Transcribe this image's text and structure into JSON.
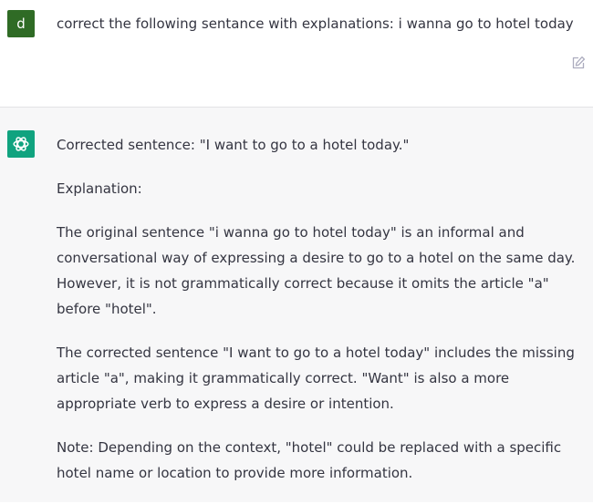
{
  "user_message": {
    "avatar_letter": "d",
    "text": "correct the following sentance with explanations: i wanna go to hotel today"
  },
  "assistant_message": {
    "paragraphs": [
      "Corrected sentence: \"I want to go to a hotel today.\"",
      "Explanation:",
      "The original sentence \"i wanna go to hotel today\" is an informal and conversational way of expressing a desire to go to a hotel on the same day. However, it is not grammatically correct because it omits the article \"a\" before \"hotel\".",
      "The corrected sentence \"I want to go to a hotel today\" includes the missing article \"a\", making it grammatically correct. \"Want\" is also a more appropriate verb to express a desire or intention.",
      "Note: Depending on the context, \"hotel\" could be replaced with a specific hotel name or location to provide more information."
    ]
  },
  "colors": {
    "user_avatar": "#2f6b25",
    "assistant_avatar": "#10a37f",
    "assistant_background": "#f7f7f8",
    "text": "#343541"
  },
  "icons": {
    "edit": "edit-icon",
    "assistant_logo": "openai-logo-icon"
  }
}
